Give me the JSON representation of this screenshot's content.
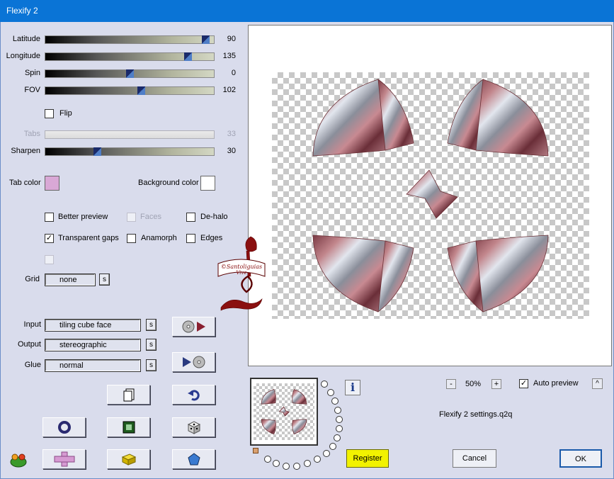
{
  "window": {
    "title": "Flexify 2"
  },
  "sliders": [
    {
      "label": "Latitude",
      "value": "90",
      "fraction": 0.97,
      "disabled": false
    },
    {
      "label": "Longitude",
      "value": "135",
      "fraction": 0.86,
      "disabled": false
    },
    {
      "label": "Spin",
      "value": "0",
      "fraction": 0.5,
      "disabled": false
    },
    {
      "label": "FOV",
      "value": "102",
      "fraction": 0.57,
      "disabled": false
    },
    {
      "label": "Tabs",
      "value": "33",
      "fraction": 0.33,
      "disabled": true
    },
    {
      "label": "Sharpen",
      "value": "30",
      "fraction": 0.3,
      "disabled": false
    }
  ],
  "flip": {
    "label": "Flip",
    "checked": false
  },
  "colors": {
    "tab_label": "Tab color",
    "tab_value": "#d9a8d6",
    "background_label": "Background color",
    "background_value": "#ffffff"
  },
  "options": {
    "better_preview": {
      "label": "Better preview",
      "checked": false
    },
    "faces": {
      "label": "Faces",
      "checked": false
    },
    "dehalo": {
      "label": "De-halo",
      "checked": false
    },
    "transparent_gaps": {
      "label": "Transparent gaps",
      "checked": true
    },
    "anamorph": {
      "label": "Anamorph",
      "checked": false
    },
    "edges": {
      "label": "Edges",
      "checked": false
    }
  },
  "grid": {
    "label": "Grid",
    "value": "none",
    "s_label": "s"
  },
  "input": {
    "label": "Input",
    "value": "tiling cube face",
    "s_label": "s"
  },
  "output": {
    "label": "Output",
    "value": "stereographic",
    "s_label": "s"
  },
  "glue": {
    "label": "Glue",
    "value": "normal",
    "s_label": "s"
  },
  "zoom": {
    "minus": "-",
    "value": "50%",
    "plus": "+"
  },
  "auto_preview": {
    "label": "Auto preview",
    "checked": true,
    "button": "^"
  },
  "settings_file": "Flexify 2 settings.q2q",
  "info_label": "i",
  "buttons": {
    "register": "Register",
    "cancel": "Cancel",
    "ok": "OK"
  },
  "watermark": {
    "line1": "©Santoliguias",
    "line2": "Vive"
  }
}
